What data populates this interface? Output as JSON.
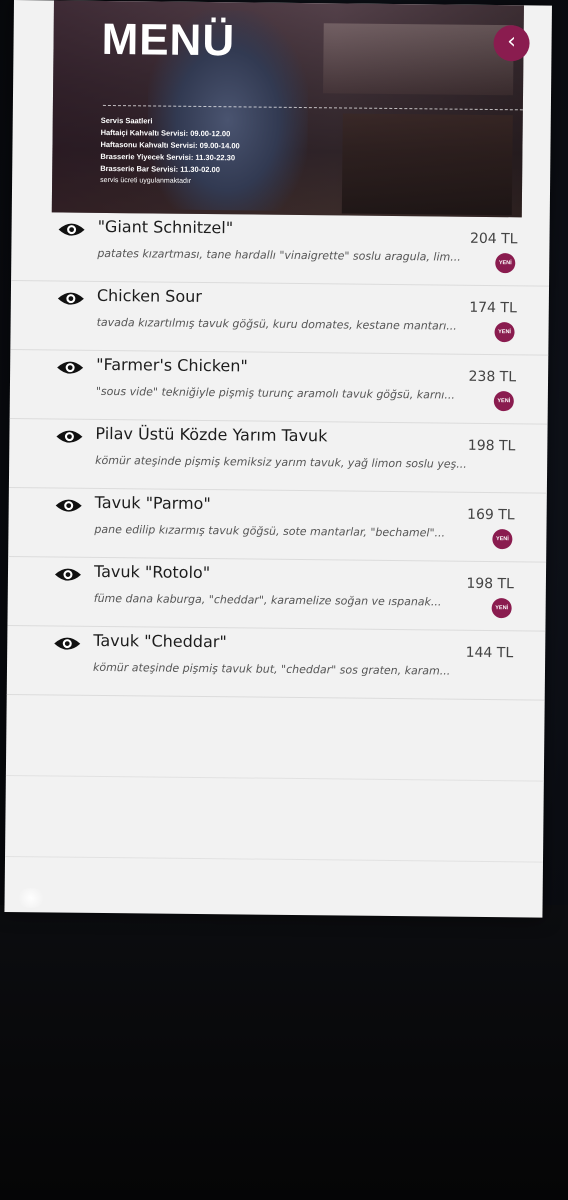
{
  "header": {
    "title": "MENÜ",
    "back_icon": "chevron-left-icon",
    "hours_title": "Servis Saatleri",
    "hours": [
      "Haftaiçi Kahvaltı Servisi: 09.00-12.00",
      "Haftasonu Kahvaltı Servisi: 09.00-14.00",
      "Brasserie Yiyecek Servisi: 11.30-22.30",
      "Brasserie Bar Servisi: 11.30-02.00"
    ],
    "service_note": "servis ücreti uygulanmaktadır"
  },
  "items": [
    {
      "name": "\"Giant Schnitzel\"",
      "price": "204 TL",
      "desc": "patates kızartması, tane hardallı \"vinaigrette\" soslu aragula, lim...",
      "badge": "YENİ"
    },
    {
      "name": "Chicken Sour",
      "price": "174 TL",
      "desc": "tavada kızartılmış tavuk göğsü, kuru domates, kestane mantarı...",
      "badge": "YENİ"
    },
    {
      "name": "\"Farmer's Chicken\"",
      "price": "238 TL",
      "desc": "\"sous vide\" tekniğiyle pişmiş turunç aramolı tavuk göğsü, karnı...",
      "badge": "YENİ"
    },
    {
      "name": "Pilav Üstü Közde Yarım Tavuk",
      "price": "198 TL",
      "desc": "kömür ateşinde pişmiş kemiksiz yarım tavuk, yağ limon soslu yeş...",
      "badge": ""
    },
    {
      "name": "Tavuk \"Parmo\"",
      "price": "169 TL",
      "desc": "pane edilip kızarmış tavuk göğsü, sote mantarlar, \"bechamel\"...",
      "badge": "YENİ"
    },
    {
      "name": "Tavuk \"Rotolo\"",
      "price": "198 TL",
      "desc": "füme dana kaburga, \"cheddar\", karamelize soğan ve ıspanak...",
      "badge": "YENİ"
    },
    {
      "name": "Tavuk \"Cheddar\"",
      "price": "144 TL",
      "desc": "kömür ateşinde pişmiş tavuk but, \"cheddar\" sos graten, karam...",
      "badge": ""
    }
  ],
  "colors": {
    "accent": "#8a1c4f",
    "list_bg": "#f2f2f2"
  }
}
